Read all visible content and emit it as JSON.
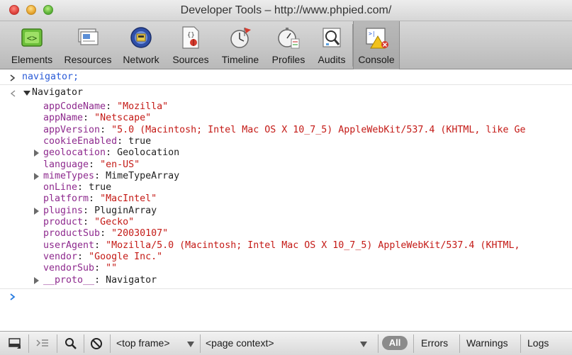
{
  "window": {
    "title": "Developer Tools – http://www.phpied.com/"
  },
  "toolbar": {
    "tabs": [
      {
        "label": "Elements",
        "icon": "elements-icon"
      },
      {
        "label": "Resources",
        "icon": "resources-icon"
      },
      {
        "label": "Network",
        "icon": "network-icon"
      },
      {
        "label": "Sources",
        "icon": "sources-icon"
      },
      {
        "label": "Timeline",
        "icon": "timeline-icon"
      },
      {
        "label": "Profiles",
        "icon": "profiles-icon"
      },
      {
        "label": "Audits",
        "icon": "audits-icon"
      },
      {
        "label": "Console",
        "icon": "console-icon"
      }
    ],
    "selected": "Console"
  },
  "console": {
    "command": "navigator;",
    "result_label": "Navigator",
    "properties": [
      {
        "name": "appCodeName",
        "value": "\"Mozilla\"",
        "kind": "string",
        "expandable": false
      },
      {
        "name": "appName",
        "value": "\"Netscape\"",
        "kind": "string",
        "expandable": false
      },
      {
        "name": "appVersion",
        "value": "\"5.0 (Macintosh; Intel Mac OS X 10_7_5) AppleWebKit/537.4 (KHTML, like Ge",
        "kind": "string",
        "expandable": false
      },
      {
        "name": "cookieEnabled",
        "value": "true",
        "kind": "plain",
        "expandable": false
      },
      {
        "name": "geolocation",
        "value": "Geolocation",
        "kind": "plain",
        "expandable": true
      },
      {
        "name": "language",
        "value": "\"en-US\"",
        "kind": "string",
        "expandable": false
      },
      {
        "name": "mimeTypes",
        "value": "MimeTypeArray",
        "kind": "plain",
        "expandable": true
      },
      {
        "name": "onLine",
        "value": "true",
        "kind": "plain",
        "expandable": false
      },
      {
        "name": "platform",
        "value": "\"MacIntel\"",
        "kind": "string",
        "expandable": false
      },
      {
        "name": "plugins",
        "value": "PluginArray",
        "kind": "plain",
        "expandable": true
      },
      {
        "name": "product",
        "value": "\"Gecko\"",
        "kind": "string",
        "expandable": false
      },
      {
        "name": "productSub",
        "value": "\"20030107\"",
        "kind": "string",
        "expandable": false
      },
      {
        "name": "userAgent",
        "value": "\"Mozilla/5.0 (Macintosh; Intel Mac OS X 10_7_5) AppleWebKit/537.4 (KHTML,",
        "kind": "string",
        "expandable": false
      },
      {
        "name": "vendor",
        "value": "\"Google Inc.\"",
        "kind": "string",
        "expandable": false
      },
      {
        "name": "vendorSub",
        "value": "\"\"",
        "kind": "string",
        "expandable": false
      },
      {
        "name": "__proto__",
        "value": "Navigator",
        "kind": "plain",
        "expandable": true
      }
    ],
    "separator": ": "
  },
  "statusbar": {
    "frame_select": "<top frame>",
    "context_select": "<page context>",
    "filter_all": "All",
    "filters": [
      "Errors",
      "Warnings",
      "Logs"
    ]
  },
  "colors": {
    "command": "#2a5bd7",
    "property_name": "#8e2a8e",
    "string_value": "#c41a16"
  }
}
